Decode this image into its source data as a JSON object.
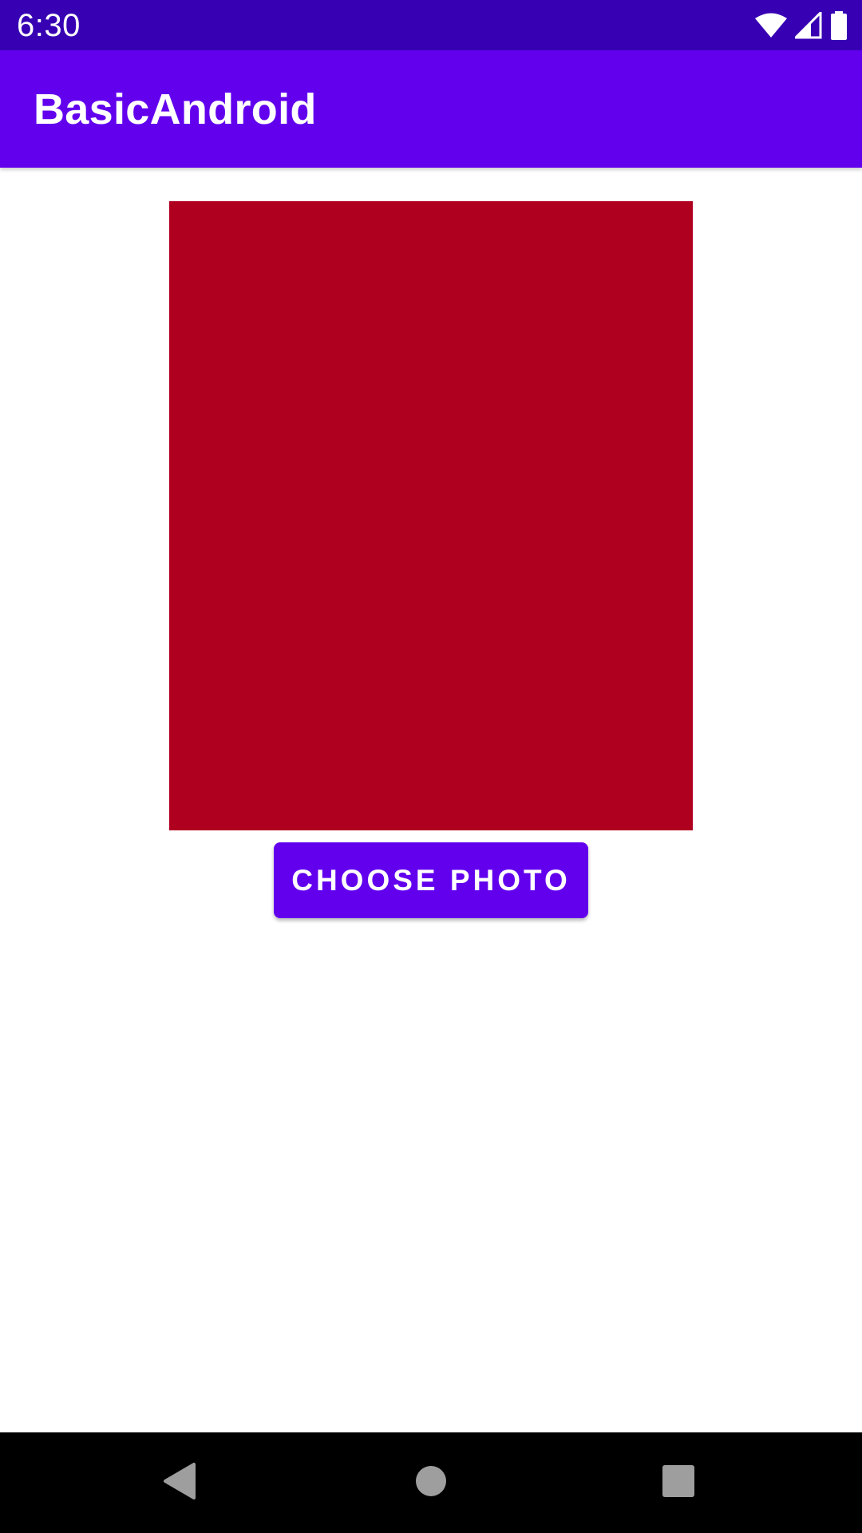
{
  "status_bar": {
    "time": "6:30",
    "icons": [
      "wifi-icon",
      "cellular-signal-icon",
      "battery-icon"
    ],
    "background": "#3700b3"
  },
  "app_bar": {
    "title": "BasicAndroid",
    "background": "#6200ee"
  },
  "photo_preview": {
    "color": "#b00020"
  },
  "choose_photo_button": {
    "label": "CHOOSE PHOTO",
    "background": "#6200ee"
  },
  "navigation_bar": {
    "buttons": [
      "back-icon",
      "home-icon",
      "recents-icon"
    ],
    "background": "#000000"
  }
}
